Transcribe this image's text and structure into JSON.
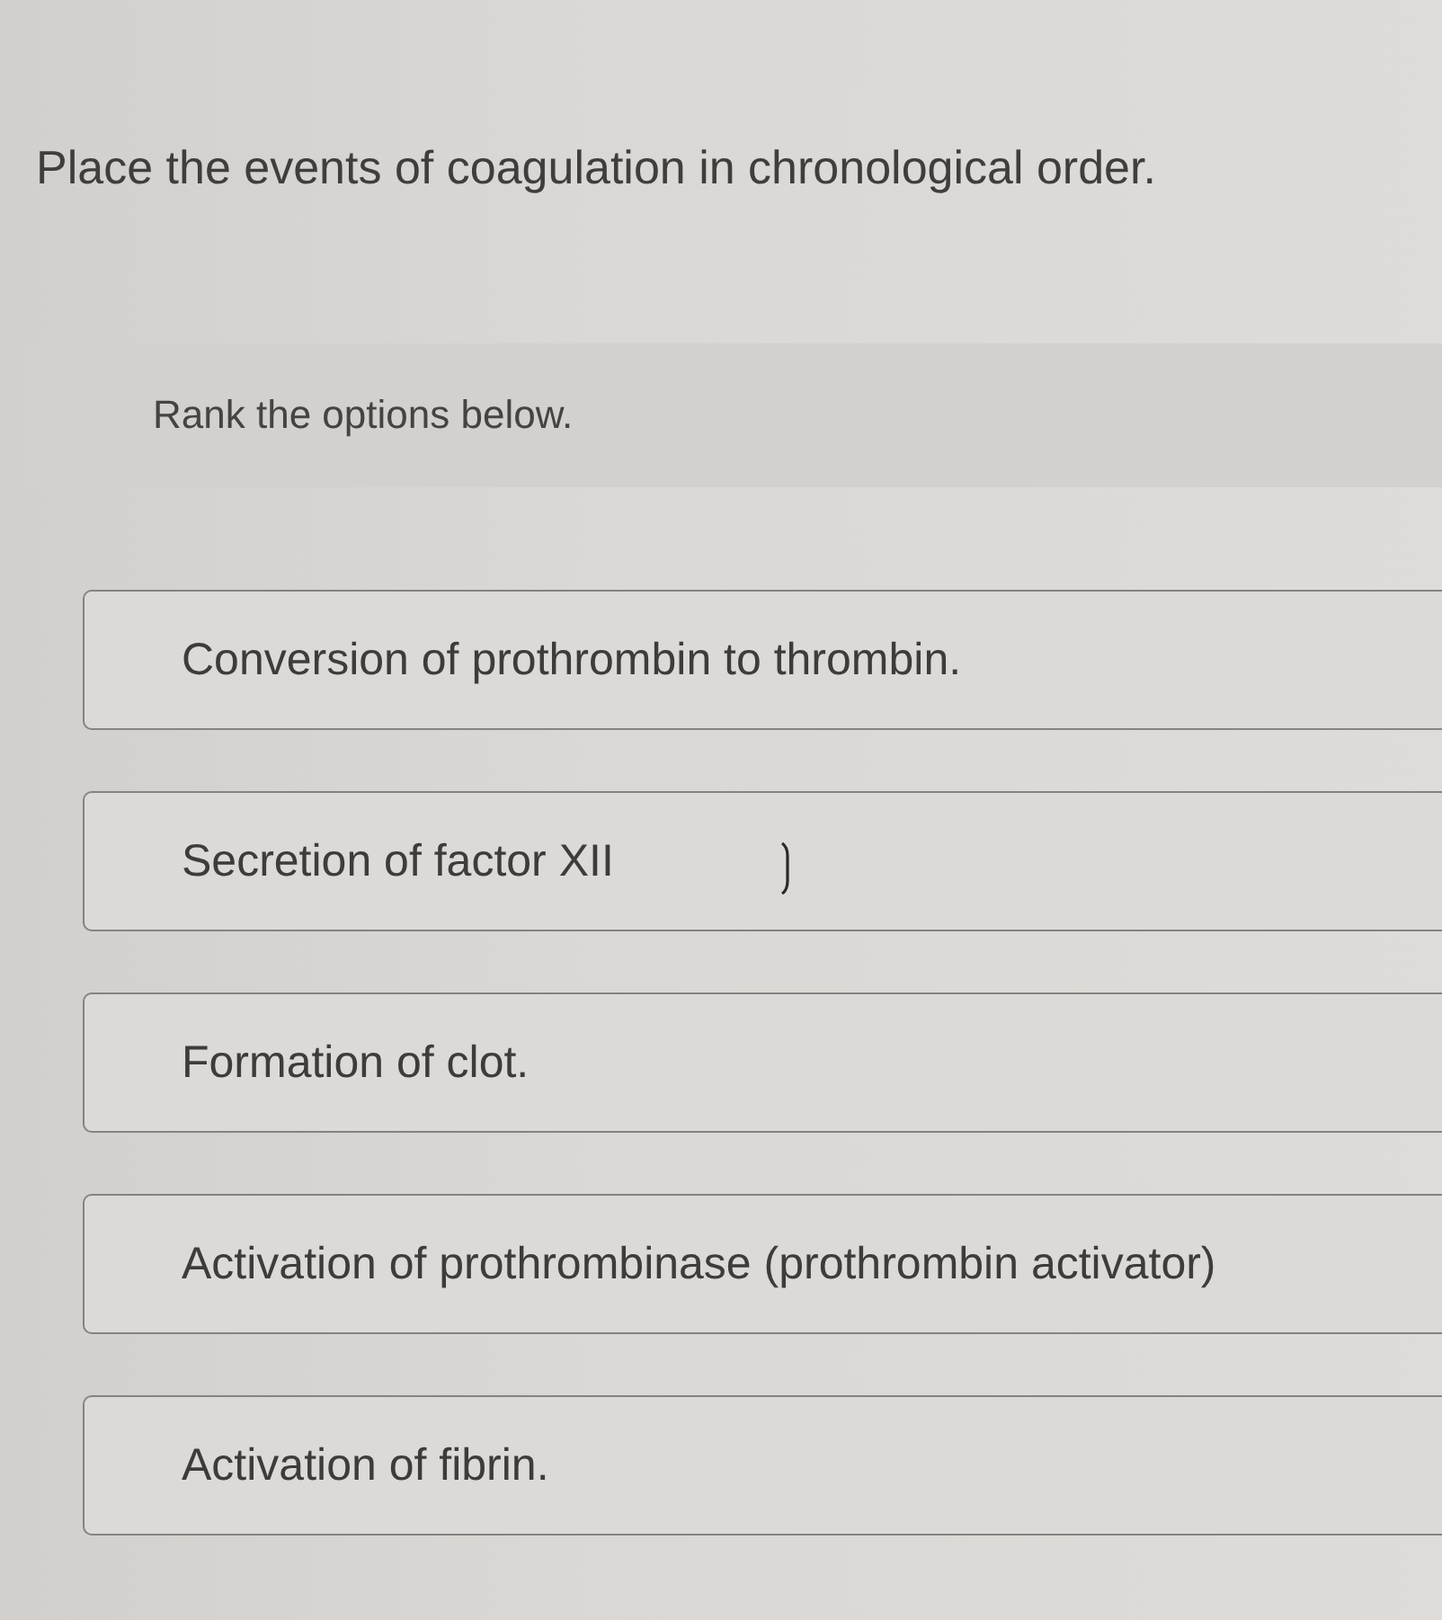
{
  "question": "Place the events of coagulation in chronological order.",
  "instruction": "Rank the options below.",
  "options": [
    {
      "text": "Conversion of prothrombin to thrombin."
    },
    {
      "text": "Secretion of factor XII"
    },
    {
      "text": "Formation of clot."
    },
    {
      "text": "Activation of prothrombinase (prothrombin activator)"
    },
    {
      "text": "Activation of fibrin."
    }
  ]
}
